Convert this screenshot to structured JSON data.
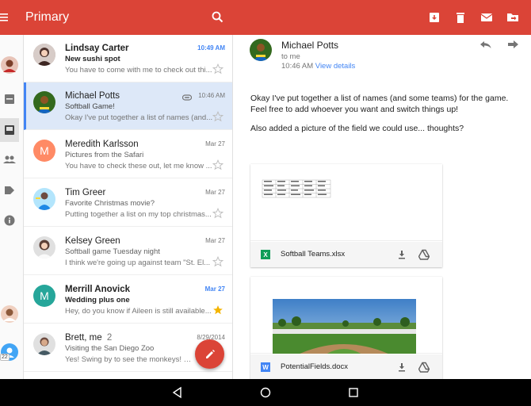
{
  "topbar": {
    "title": "Primary",
    "actions": [
      "archive-icon",
      "delete-icon",
      "mark-unread-icon",
      "move-to-icon"
    ],
    "color": "#db4437"
  },
  "rail": {
    "items": [
      "account-avatar",
      "archive-box-icon",
      "inbox-icon",
      "people-icon",
      "label-icon",
      "info-icon",
      "account-avatar-2",
      "account-avatar-3"
    ],
    "badge": "22"
  },
  "emails": [
    {
      "sender": "Lindsay Carter",
      "date": "10:49 AM",
      "subject": "New sushi spot",
      "snippet": "You have to come with me to check out thi...",
      "unread": true,
      "starred": false,
      "avatar_letter": "",
      "avatar_color": "#bcaaa4"
    },
    {
      "sender": "Michael Potts",
      "date": "10:46 AM",
      "subject": "Softball Game!",
      "snippet": "Okay I've put together a list of names (and...",
      "unread": false,
      "starred": false,
      "selected": true,
      "avatar_letter": "",
      "avatar_color": "#5d4037"
    },
    {
      "sender": "Meredith Karlsson",
      "date": "Mar 27",
      "subject": "Pictures from the Safari",
      "snippet": "You have to check these out, let me know ...",
      "unread": false,
      "starred": false,
      "avatar_letter": "M",
      "avatar_color": "#ff8a65"
    },
    {
      "sender": "Tim Greer",
      "date": "Mar 27",
      "subject": "Favorite Christmas movie?",
      "snippet": "Putting together a list on my top christmas...",
      "unread": false,
      "starred": false,
      "avatar_letter": "",
      "avatar_color": "#8d6e63"
    },
    {
      "sender": "Kelsey Green",
      "date": "Mar 27",
      "subject": "Softball game Tuesday night",
      "snippet": "I think we're going up against team \"St. El...",
      "unread": false,
      "starred": false,
      "avatar_letter": "",
      "avatar_color": "#a1887f"
    },
    {
      "sender": "Merrill Anovick",
      "date": "Mar 27",
      "subject": "Wedding plus one",
      "snippet": "Hey, do you know if Aileen is still available...",
      "unread": true,
      "starred": true,
      "avatar_letter": "M",
      "avatar_color": "#26a69a"
    },
    {
      "sender": "Brett, me",
      "count": "2",
      "date": "8/29/2014",
      "subject": "Visiting the San Diego Zoo",
      "snippet": "Yes! Swing by to see the monkeys! On F...",
      "unread": false,
      "starred": false,
      "avatar_letter": "",
      "avatar_color": "#6d4c41"
    }
  ],
  "detail": {
    "from": "Michael Potts",
    "to": "to me",
    "time": "10:46 AM",
    "view_details": "View details",
    "body": [
      "Okay I've put together a list of names (and some teams) for the game. Feel free to add whoever you want and switch things up!",
      "Also added a picture of the field we could use... thoughts?"
    ],
    "attachments": [
      {
        "name": "Softball Teams.xlsx",
        "type_letter": "X",
        "type_color": "#0f9d58"
      },
      {
        "name": "PotentialFields.docx",
        "type_letter": "W",
        "type_color": "#4285f4"
      }
    ]
  },
  "navbar": [
    "back-icon",
    "home-icon",
    "recents-icon"
  ]
}
